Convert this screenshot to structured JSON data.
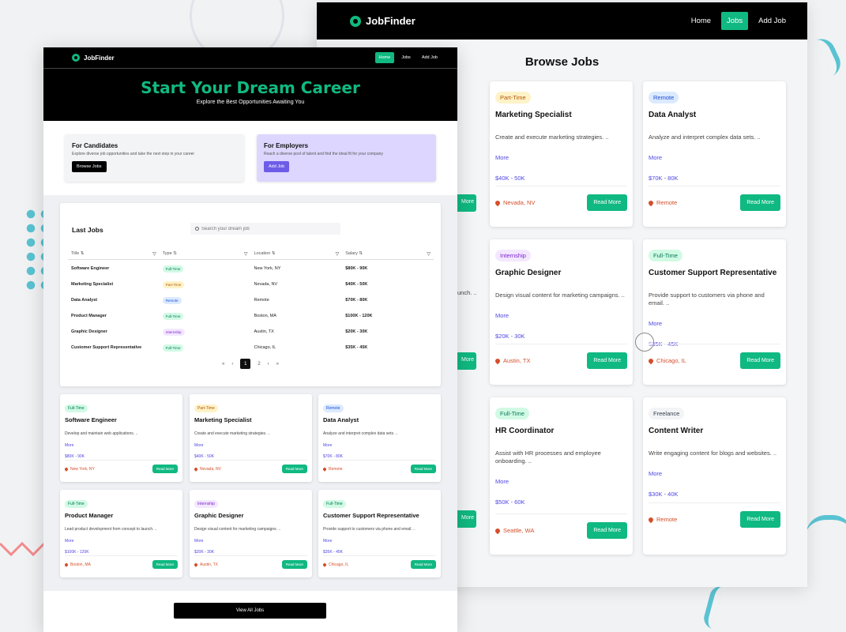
{
  "brand": "JobFinder",
  "colors": {
    "accent": "#10b981",
    "link": "#4f46e5",
    "location": "#d54e2a",
    "employer_card": "#ddd6fe"
  },
  "nav": {
    "home": "Home",
    "jobs": "Jobs",
    "add_job": "Add Job",
    "active": "Jobs"
  },
  "hero": {
    "title": "Start Your Dream Career",
    "subtitle": "Explore the Best Opportunities Awaiting You"
  },
  "candidates": {
    "title": "For Candidates",
    "text": "Explore diverse job opportunities and take the next step in your career",
    "button": "Browse Jobs"
  },
  "employers": {
    "title": "For Employers",
    "text": "Reach a diverse pool of talent and find the ideal fit for your company",
    "button": "Add Job"
  },
  "last_jobs": {
    "title": "Last Jobs",
    "search_placeholder": "Search your dream job",
    "columns": [
      "Title ⇅",
      "Type ⇅",
      "Location ⇅",
      "Salary ⇅"
    ],
    "rows": [
      {
        "title": "Software Engineer",
        "type": "Full-Time",
        "location": "New York, NY",
        "salary": "$80K - 90K"
      },
      {
        "title": "Marketing Specialist",
        "type": "Part-Time",
        "location": "Nevada, NV",
        "salary": "$40K - 50K"
      },
      {
        "title": "Data Analyst",
        "type": "Remote",
        "location": "Remote",
        "salary": "$70K - 80K"
      },
      {
        "title": "Product Manager",
        "type": "Full-Time",
        "location": "Boston, MA",
        "salary": "$100K - 120K"
      },
      {
        "title": "Graphic Designer",
        "type": "Internship",
        "location": "Austin, TX",
        "salary": "$20K - 30K"
      },
      {
        "title": "Customer Support Representative",
        "type": "Full-Time",
        "location": "Chicago, IL",
        "salary": "$35K - 45K"
      }
    ],
    "pager": {
      "first": "«",
      "prev": "‹",
      "page1": "1",
      "page2": "2",
      "next": "›",
      "last": "»"
    }
  },
  "front_cards": [
    {
      "badge": "Full-Time",
      "title": "Software Engineer",
      "desc": "Develop and maintain web applications. ..",
      "more": "More",
      "salary": "$80K - 90K",
      "location": "New York, NY",
      "button": "Read More"
    },
    {
      "badge": "Part-Time",
      "title": "Marketing Specialist",
      "desc": "Create and execute marketing strategies. ..",
      "more": "More",
      "salary": "$40K - 50K",
      "location": "Nevada, NV",
      "button": "Read More"
    },
    {
      "badge": "Remote",
      "title": "Data Analyst",
      "desc": "Analyze and interpret complex data sets. ..",
      "more": "More",
      "salary": "$70K - 80K",
      "location": "Remote",
      "button": "Read More"
    },
    {
      "badge": "Full-Time",
      "title": "Product Manager",
      "desc": "Lead product development from concept to launch. ..",
      "more": "More",
      "salary": "$100K - 120K",
      "location": "Boston, MA",
      "button": "Read More"
    },
    {
      "badge": "Internship",
      "title": "Graphic Designer",
      "desc": "Design visual content for marketing campaigns. ..",
      "more": "More",
      "salary": "$20K - 30K",
      "location": "Austin, TX",
      "button": "Read More"
    },
    {
      "badge": "Full-Time",
      "title": "Customer Support Representative",
      "desc": "Provide support to customers via phone and email. ..",
      "more": "More",
      "salary": "$35K - 45K",
      "location": "Chicago, IL",
      "button": "Read More"
    }
  ],
  "view_all": "View All Jobs",
  "browse": {
    "title": "Browse Jobs",
    "partial_button": "More",
    "partial_text": "unch. ..",
    "cards": [
      {
        "badge": "Part-Time",
        "title": "Marketing Specialist",
        "desc": "Create and execute marketing strategies. ..",
        "more": "More",
        "salary": "$40K - 50K",
        "location": "Nevada, NV",
        "button": "Read More"
      },
      {
        "badge": "Remote",
        "title": "Data Analyst",
        "desc": "Analyze and interpret complex data sets. ..",
        "more": "More",
        "salary": "$70K - 80K",
        "location": "Remote",
        "button": "Read More"
      },
      {
        "badge": "Internship",
        "title": "Graphic Designer",
        "desc": "Design visual content for marketing campaigns. ..",
        "more": "More",
        "salary": "$20K - 30K",
        "location": "Austin, TX",
        "button": "Read More"
      },
      {
        "badge": "Full-Time",
        "title": "Customer Support Representative",
        "desc": "Provide support to customers via phone and email. ..",
        "more": "More",
        "salary": "$35K - 45K",
        "location": "Chicago, IL",
        "button": "Read More"
      },
      {
        "badge": "Full-Time",
        "title": "HR Coordinator",
        "desc": "Assist with HR processes and employee onboarding. ..",
        "more": "More",
        "salary": "$50K - 60K",
        "location": "Seattle, WA",
        "button": "Read More"
      },
      {
        "badge": "Freelance",
        "title": "Content Writer",
        "desc": "Write engaging content for blogs and websites. ..",
        "more": "More",
        "salary": "$30K - 40K",
        "location": "Remote",
        "button": "Read More"
      }
    ]
  }
}
